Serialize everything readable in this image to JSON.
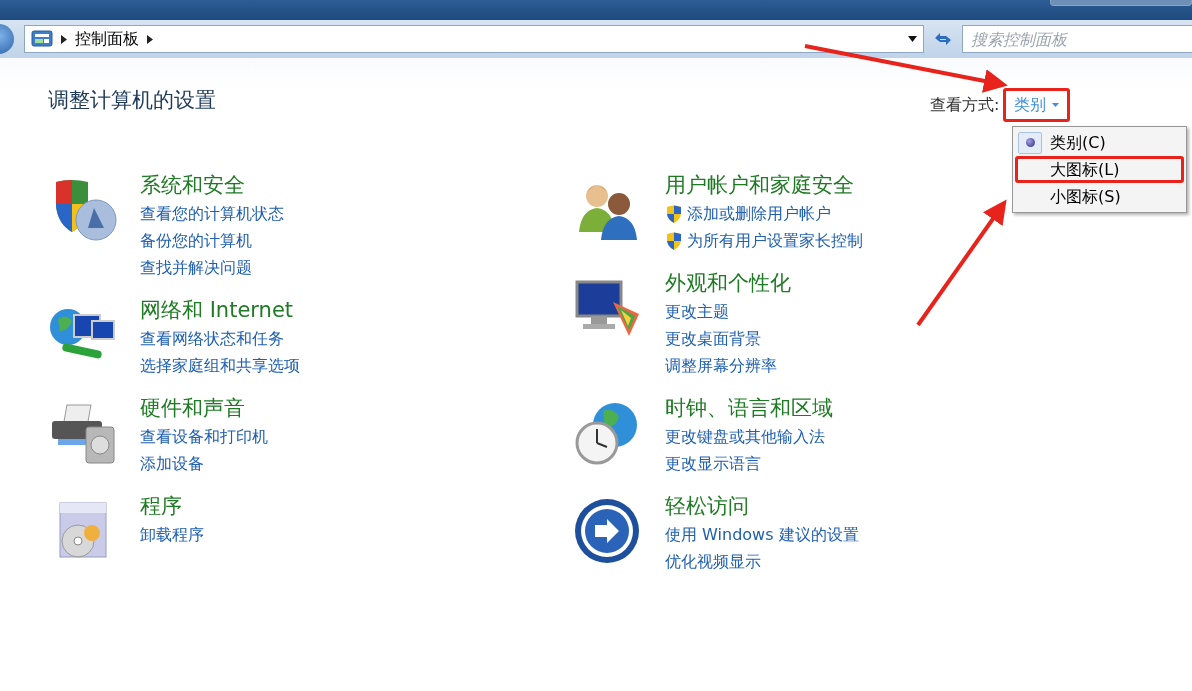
{
  "address_bar": {
    "path": [
      "控制面板"
    ],
    "search": {
      "placeholder": "搜索控制面板"
    }
  },
  "page_title": "调整计算机的设置",
  "view_by": {
    "label": "查看方式:",
    "value": "类别",
    "expanded": true,
    "highlighted": true,
    "menu": [
      {
        "label": "类别(C)",
        "selected": true,
        "highlighted": false
      },
      {
        "label": "大图标(L)",
        "selected": false,
        "highlighted": true
      },
      {
        "label": "小图标(S)",
        "selected": false,
        "highlighted": false
      }
    ]
  },
  "columns": [
    [
      {
        "title": "系统和安全",
        "links": [
          {
            "text": "查看您的计算机状态",
            "shield": false
          },
          {
            "text": "备份您的计算机",
            "shield": false
          },
          {
            "text": "查找并解决问题",
            "shield": false
          }
        ]
      },
      {
        "title": "网络和 Internet",
        "links": [
          {
            "text": "查看网络状态和任务",
            "shield": false
          },
          {
            "text": "选择家庭组和共享选项",
            "shield": false
          }
        ]
      },
      {
        "title": "硬件和声音",
        "links": [
          {
            "text": "查看设备和打印机",
            "shield": false
          },
          {
            "text": "添加设备",
            "shield": false
          }
        ]
      },
      {
        "title": "程序",
        "links": [
          {
            "text": "卸载程序",
            "shield": false
          }
        ]
      }
    ],
    [
      {
        "title": "用户帐户和家庭安全",
        "links": [
          {
            "text": "添加或删除用户帐户",
            "shield": true
          },
          {
            "text": "为所有用户设置家长控制",
            "shield": true
          }
        ]
      },
      {
        "title": "外观和个性化",
        "links": [
          {
            "text": "更改主题",
            "shield": false
          },
          {
            "text": "更改桌面背景",
            "shield": false
          },
          {
            "text": "调整屏幕分辨率",
            "shield": false
          }
        ]
      },
      {
        "title": "时钟、语言和区域",
        "links": [
          {
            "text": "更改键盘或其他输入法",
            "shield": false
          },
          {
            "text": "更改显示语言",
            "shield": false
          }
        ]
      },
      {
        "title": "轻松访问",
        "links": [
          {
            "text": "使用 Windows 建议的设置",
            "shield": false
          },
          {
            "text": "优化视频显示",
            "shield": false
          }
        ]
      }
    ]
  ]
}
